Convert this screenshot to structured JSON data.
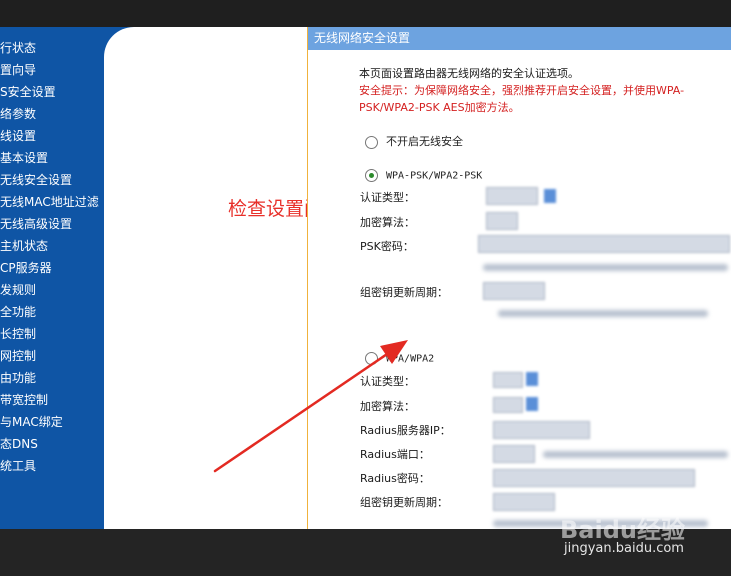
{
  "sidebar": {
    "items": [
      {
        "label": "行状态"
      },
      {
        "label": "置向导"
      },
      {
        "label": "S安全设置"
      },
      {
        "label": "络参数"
      },
      {
        "label": "线设置"
      },
      {
        "label": "基本设置"
      },
      {
        "label": "无线安全设置"
      },
      {
        "label": "无线MAC地址过滤"
      },
      {
        "label": "无线高级设置"
      },
      {
        "label": "主机状态"
      },
      {
        "label": "CP服务器"
      },
      {
        "label": "发规则"
      },
      {
        "label": "全功能"
      },
      {
        "label": "长控制"
      },
      {
        "label": "网控制"
      },
      {
        "label": "由功能"
      },
      {
        "label": "带宽控制"
      },
      {
        "label": "与MAC绑定"
      },
      {
        "label": "态DNS"
      },
      {
        "label": "统工具"
      }
    ]
  },
  "annotation": {
    "text": "检查设置问题",
    "color": "#e8302a"
  },
  "panel": {
    "title": "无线网络安全设置",
    "intro": "本页面设置路由器无线网络的安全认证选项。",
    "warning": "安全提示：为保障网络安全，强烈推荐开启安全设置，并使用WPA-PSK/WPA2-PSK AES加密方法。",
    "options": {
      "none": {
        "label": "不开启无线安全",
        "checked": false
      },
      "psk": {
        "label": "WPA-PSK/WPA2-PSK",
        "checked": true
      },
      "enterprise": {
        "label": "WPA/WPA2",
        "checked": false
      }
    },
    "psk_fields": {
      "auth_type": "认证类型：",
      "encryption": "加密算法：",
      "psk_password": "PSK密码：",
      "group_key_period": "组密钥更新周期："
    },
    "enterprise_fields": {
      "auth_type": "认证类型：",
      "encryption": "加密算法：",
      "radius_ip": "Radius服务器IP：",
      "radius_port": "Radius端口：",
      "radius_password": "Radius密码：",
      "group_key_period": "组密钥更新周期："
    }
  },
  "watermark": {
    "logo": "Baidu经验",
    "url": "jingyan.baidu.com"
  },
  "colors": {
    "sidebar": "#0f55a5",
    "header": "#6da3e0",
    "accent_red": "#d42020"
  }
}
